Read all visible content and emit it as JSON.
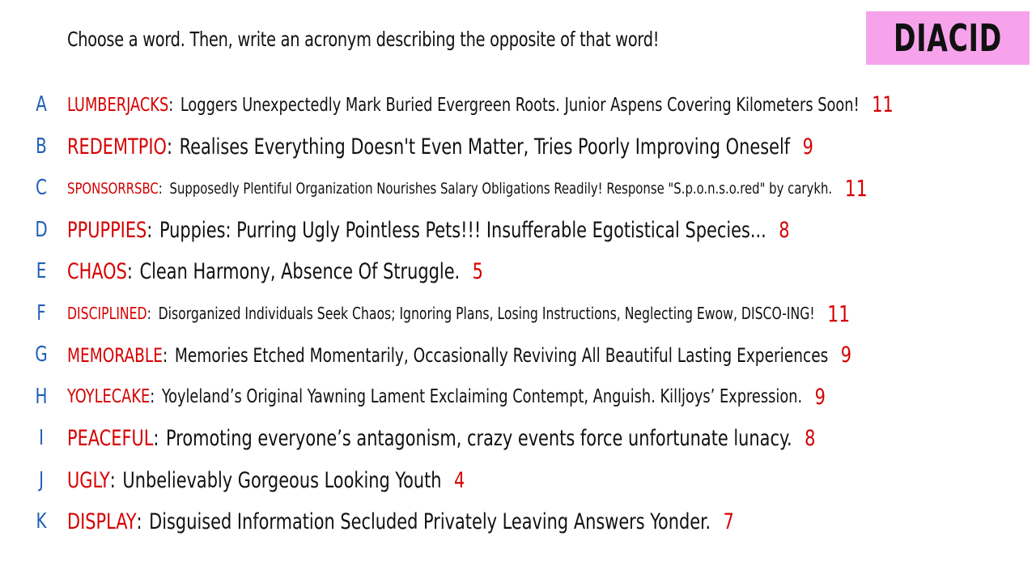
{
  "header": {
    "prompt": "Choose a word. Then, write an acronym describing the opposite of that word!",
    "title": "DIACID"
  },
  "entries": [
    {
      "letter": "A",
      "word": "LUMBERJACKS",
      "acronym": "Loggers Unexpectedly Mark Buried Evergreen Roots. Junior Aspens Covering Kilometers Soon!",
      "count": "11"
    },
    {
      "letter": "B",
      "word": "REDEMTPIO",
      "acronym": "Realises Everything Doesn't Even Matter, Tries Poorly Improving Oneself",
      "count": "9"
    },
    {
      "letter": "C",
      "word": "SPONSORRSBC",
      "acronym": "Supposedly Plentiful Organization Nourishes Salary Obligations Readily! Response \"S.p.o.n.s.o.red\" by carykh.",
      "count": "11"
    },
    {
      "letter": "D",
      "word": "PPUPPIES",
      "acronym": "Puppies: Purring Ugly Pointless Pets!!! Insufferable Egotistical Species...",
      "count": "8"
    },
    {
      "letter": "E",
      "word": "CHAOS",
      "acronym": "Clean Harmony, Absence Of Struggle.",
      "count": "5"
    },
    {
      "letter": "F",
      "word": "DISCIPLINED",
      "acronym": "Disorganized Individuals Seek Chaos; Ignoring Plans, Losing Instructions, Neglecting Ewow, DISCO-ING!",
      "count": "11"
    },
    {
      "letter": "G",
      "word": "MEMORABLE",
      "acronym": "Memories Etched Momentarily, Occasionally Reviving All Beautiful Lasting Experiences",
      "count": "9"
    },
    {
      "letter": "H",
      "word": "YOYLECAKE",
      "acronym": "Yoyleland’s Original Yawning Lament Exclaiming Contempt, Anguish. Killjoys’ Expression.",
      "count": "9"
    },
    {
      "letter": "I",
      "word": "PEACEFUL",
      "acronym": "Promoting everyone’s antagonism, crazy events force unfortunate lunacy.",
      "count": "8"
    },
    {
      "letter": "J",
      "word": "UGLY",
      "acronym": "Unbelievably Gorgeous Looking Youth",
      "count": "4"
    },
    {
      "letter": "K",
      "word": "DISPLAY",
      "acronym": "Disguised Information Secluded Privately Leaving Answers Yonder.",
      "count": "7"
    }
  ],
  "colors": {
    "letter": "#1f5fb8",
    "word": "#d60000",
    "text": "#111111",
    "title_bg": "#f6a3ec"
  }
}
